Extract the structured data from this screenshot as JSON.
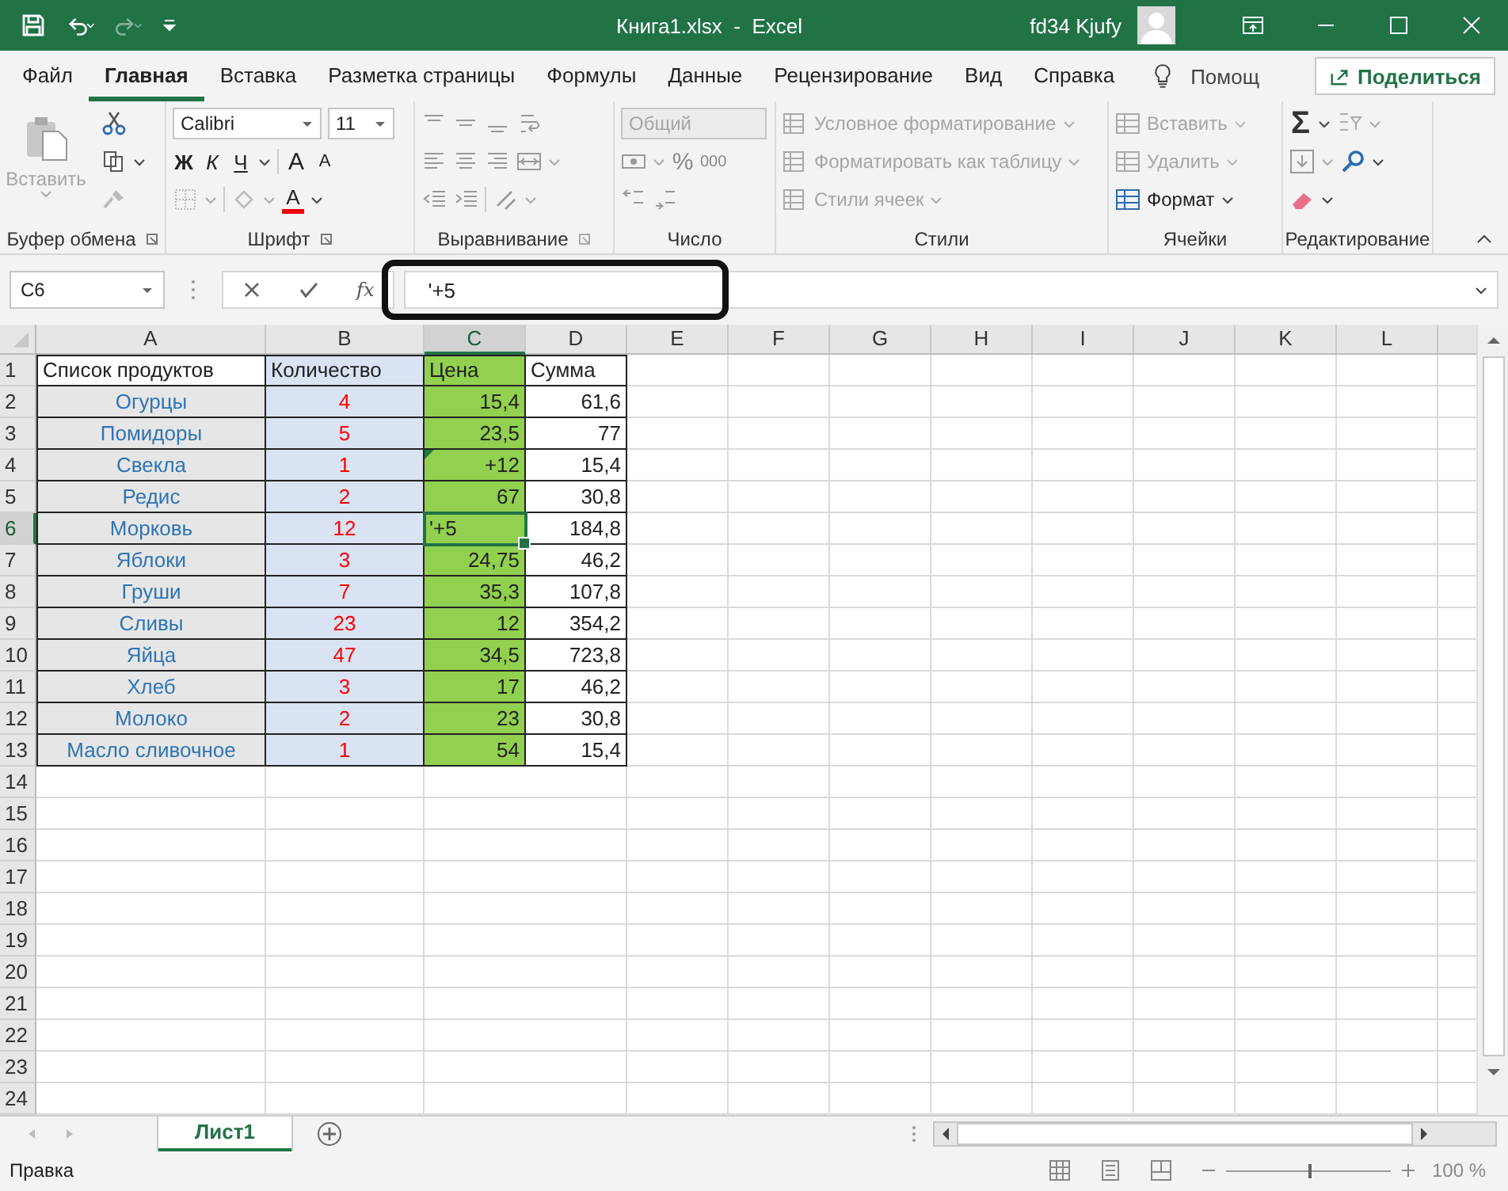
{
  "titlebar": {
    "title": "Книга1.xlsx  -  Excel",
    "user": "fd34 Kjufy"
  },
  "menu_tabs": [
    {
      "label": "Файл",
      "selected": false
    },
    {
      "label": "Главная",
      "selected": true
    },
    {
      "label": "Вставка",
      "selected": false
    },
    {
      "label": "Разметка страницы",
      "selected": false
    },
    {
      "label": "Формулы",
      "selected": false
    },
    {
      "label": "Данные",
      "selected": false
    },
    {
      "label": "Рецензирование",
      "selected": false
    },
    {
      "label": "Вид",
      "selected": false
    },
    {
      "label": "Справка",
      "selected": false
    }
  ],
  "tell_me": "Помощ",
  "share": "Поделиться",
  "ribbon": {
    "clipboard": {
      "label": "Буфер обмена",
      "paste": "Вставить",
      "paste_disabled": true
    },
    "font": {
      "label": "Шрифт",
      "family": "Calibri",
      "size": "11",
      "bold": "Ж",
      "italic": "К",
      "underline": "Ч",
      "grow": "A",
      "shrink": "A",
      "text_color_button": "A"
    },
    "alignment": {
      "label": "Выравнивание"
    },
    "number": {
      "label": "Число",
      "format": "Общий",
      "format_disabled": true,
      "percent": "%",
      "thousands": "000"
    },
    "styles": {
      "label": "Стили",
      "items": [
        {
          "label": "Условное форматирование",
          "disabled": true
        },
        {
          "label": "Форматировать как таблицу",
          "disabled": true
        },
        {
          "label": "Стили ячеек",
          "disabled": true
        }
      ]
    },
    "cells": {
      "label": "Ячейки",
      "items": [
        {
          "label": "Вставить",
          "disabled": true
        },
        {
          "label": "Удалить",
          "disabled": true
        },
        {
          "label": "Формат",
          "disabled": false
        }
      ]
    },
    "editing": {
      "label": "Редактирование",
      "sum": "Σ"
    }
  },
  "formula_bar": {
    "name_box": "C6",
    "fx": "fx",
    "value": "'+5"
  },
  "columns": [
    {
      "label": "A",
      "selected": false
    },
    {
      "label": "B",
      "selected": false
    },
    {
      "label": "C",
      "selected": true
    },
    {
      "label": "D",
      "selected": false
    },
    {
      "label": "E",
      "selected": false
    },
    {
      "label": "F",
      "selected": false
    },
    {
      "label": "G",
      "selected": false
    },
    {
      "label": "H",
      "selected": false
    },
    {
      "label": "I",
      "selected": false
    },
    {
      "label": "J",
      "selected": false
    },
    {
      "label": "K",
      "selected": false
    },
    {
      "label": "L",
      "selected": false
    }
  ],
  "rows": [
    {
      "label": "1",
      "kind": "header",
      "selected": false,
      "flagged": false,
      "cells": [
        "Список продуктов",
        "Количество",
        "Цена",
        "Сумма"
      ]
    },
    {
      "label": "2",
      "kind": "data",
      "selected": false,
      "flagged": false,
      "cells": [
        "Огурцы",
        "4",
        "15,4",
        "61,6"
      ]
    },
    {
      "label": "3",
      "kind": "data",
      "selected": false,
      "flagged": false,
      "cells": [
        "Помидоры",
        "5",
        "23,5",
        "77"
      ]
    },
    {
      "label": "4",
      "kind": "data",
      "selected": false,
      "flagged": true,
      "cells": [
        "Свекла",
        "1",
        "+12",
        "15,4"
      ]
    },
    {
      "label": "5",
      "kind": "data",
      "selected": false,
      "flagged": false,
      "cells": [
        "Редис",
        "2",
        "67",
        "30,8"
      ]
    },
    {
      "label": "6",
      "kind": "data",
      "selected": true,
      "flagged": false,
      "cells": [
        "Морковь",
        "12",
        "'+5",
        "184,8"
      ]
    },
    {
      "label": "7",
      "kind": "data",
      "selected": false,
      "flagged": false,
      "cells": [
        "Яблоки",
        "3",
        "24,75",
        "46,2"
      ]
    },
    {
      "label": "8",
      "kind": "data",
      "selected": false,
      "flagged": false,
      "cells": [
        "Груши",
        "7",
        "35,3",
        "107,8"
      ]
    },
    {
      "label": "9",
      "kind": "data",
      "selected": false,
      "flagged": false,
      "cells": [
        "Сливы",
        "23",
        "12",
        "354,2"
      ]
    },
    {
      "label": "10",
      "kind": "data",
      "selected": false,
      "flagged": false,
      "cells": [
        "Яйца",
        "47",
        "34,5",
        "723,8"
      ]
    },
    {
      "label": "11",
      "kind": "data",
      "selected": false,
      "flagged": false,
      "cells": [
        "Хлеб",
        "3",
        "17",
        "46,2"
      ]
    },
    {
      "label": "12",
      "kind": "data",
      "selected": false,
      "flagged": false,
      "cells": [
        "Молоко",
        "2",
        "23",
        "30,8"
      ]
    },
    {
      "label": "13",
      "kind": "data",
      "selected": false,
      "flagged": false,
      "cells": [
        "Масло сливочное",
        "1",
        "54",
        "15,4"
      ]
    },
    {
      "label": "14",
      "selected": false,
      "flagged": false,
      "cells": []
    },
    {
      "label": "15",
      "selected": false,
      "flagged": false,
      "cells": []
    },
    {
      "label": "16",
      "selected": false,
      "flagged": false,
      "cells": []
    },
    {
      "label": "17",
      "selected": false,
      "flagged": false,
      "cells": []
    },
    {
      "label": "18",
      "selected": false,
      "flagged": false,
      "cells": []
    },
    {
      "label": "19",
      "selected": false,
      "flagged": false,
      "cells": []
    },
    {
      "label": "20",
      "selected": false,
      "flagged": false,
      "cells": []
    },
    {
      "label": "21",
      "selected": false,
      "flagged": false,
      "cells": []
    },
    {
      "label": "22",
      "selected": false,
      "flagged": false,
      "cells": []
    },
    {
      "label": "23",
      "selected": false,
      "flagged": false,
      "cells": []
    },
    {
      "label": "24",
      "selected": false,
      "flagged": false,
      "cells": []
    }
  ],
  "sheet_tabs": [
    {
      "label": "Лист1",
      "selected": true
    }
  ],
  "status": {
    "mode": "Правка",
    "zoom": {
      "level": 0.5,
      "reading": "100 %"
    }
  }
}
